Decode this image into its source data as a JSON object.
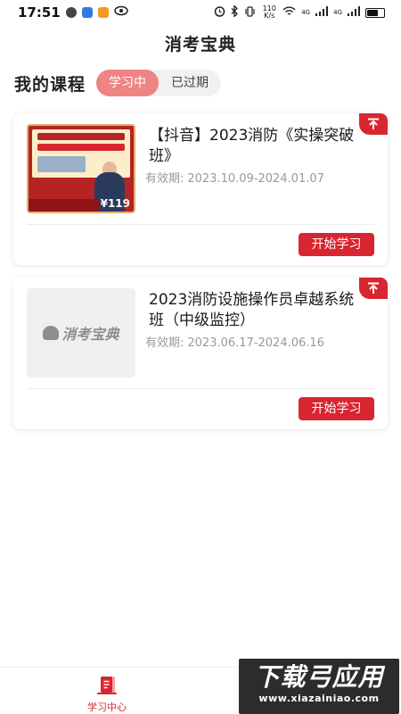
{
  "status_bar": {
    "time": "17:51",
    "network_speed": "110 K/s",
    "signal_1": "4G",
    "signal_2": "4G",
    "battery_level": 0.6
  },
  "header": {
    "title": "消考宝典"
  },
  "section": {
    "title": "我的课程",
    "tabs": [
      {
        "label": "学习中",
        "active": true
      },
      {
        "label": "已过期",
        "active": false
      }
    ]
  },
  "courses": [
    {
      "title": "【抖音】2023消防《实操突破班》",
      "validity_label": "有效期:",
      "validity_range": "2023.10.09-2024.01.07",
      "button_label": "开始学习",
      "thumbnail_price": "¥119"
    },
    {
      "title": "2023消防设施操作员卓越系统班（中级监控）",
      "validity_label": "有效期:",
      "validity_range": "2023.06.17-2024.06.16",
      "button_label": "开始学习",
      "thumbnail_text": "消考宝典"
    }
  ],
  "bottom_nav": {
    "items": [
      {
        "label": "学习中心",
        "active": true
      }
    ]
  },
  "watermark": {
    "main": "下载弓应用",
    "sub": "www.xiazainiao.com"
  },
  "colors": {
    "accent": "#d9252f",
    "tab_active_bg": "#ef8484"
  }
}
